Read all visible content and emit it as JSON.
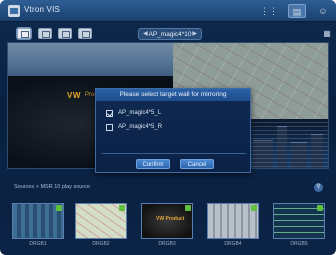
{
  "app": {
    "title": "Vtron VIS"
  },
  "header": {
    "icons": [
      "grid-view-icon",
      "layout-icon",
      "user-icon"
    ],
    "active_icon": "layout-icon"
  },
  "toolbar": {
    "wall_name": "AP_magic4*10",
    "tools": [
      "layout-mode-icon",
      "monitor-icon",
      "camera-icon",
      "settings-icon"
    ]
  },
  "wall": {
    "tiles": [
      "sky-view",
      "city-map",
      "vw-product-video",
      "night-city"
    ],
    "watermark": "VW",
    "watermark_sub": "Product"
  },
  "dialog": {
    "title": "Please select target wall for mirroring",
    "options": [
      {
        "label": "AP_magic4*5_L",
        "checked": true
      },
      {
        "label": "AP_magic4*5_R",
        "checked": false
      }
    ],
    "confirm_label": "Confirm",
    "cancel_label": "Cancel"
  },
  "sources": {
    "label": "Sources > MSR 10 play source",
    "items": [
      {
        "caption": "DRGB1"
      },
      {
        "caption": "DRGB2"
      },
      {
        "caption": "DRGB3",
        "text": "VW Product"
      },
      {
        "caption": "DRGB4"
      },
      {
        "caption": "DRGB5"
      }
    ]
  },
  "colors": {
    "background": "#0b2344",
    "accent": "#2e66ad",
    "status_ok": "#5fbf3f"
  }
}
